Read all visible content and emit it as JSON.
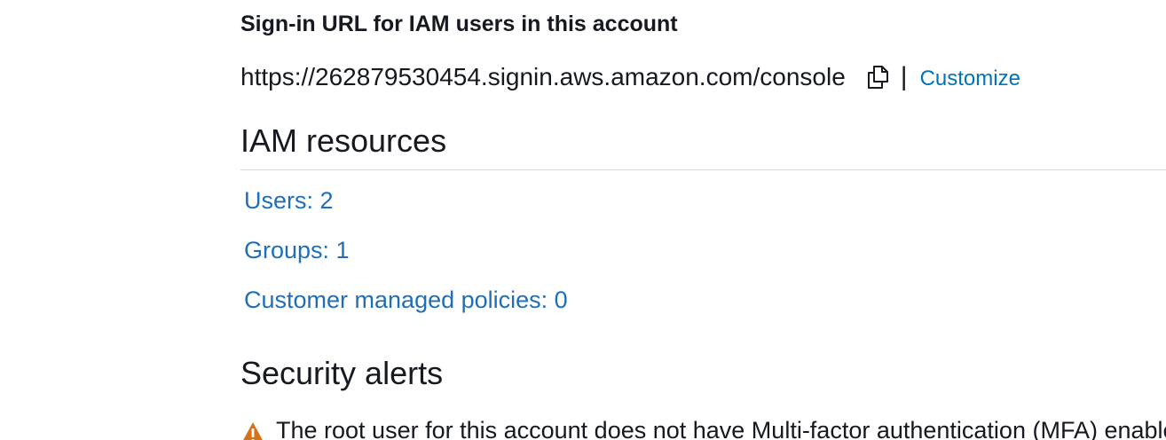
{
  "signin": {
    "title": "Sign-in URL for IAM users in this account",
    "url": "https://262879530454.signin.aws.amazon.com/console",
    "copy_icon": "copy-icon",
    "separator": "|",
    "customize_label": "Customize"
  },
  "resources": {
    "heading": "IAM resources",
    "links": [
      {
        "label": "Users: 2"
      },
      {
        "label": "Groups: 1"
      },
      {
        "label": "Customer managed policies: 0"
      }
    ]
  },
  "alerts": {
    "heading": "Security alerts",
    "icon": "warning-icon",
    "message": "The root user for this account does not have Multi-factor authentication (MFA) enabled. Enable MFA to improve security for this account."
  },
  "colors": {
    "link": "#1f6fb8",
    "text": "#16191f",
    "divider": "#d5dbdb",
    "warning": "#d4721c"
  }
}
